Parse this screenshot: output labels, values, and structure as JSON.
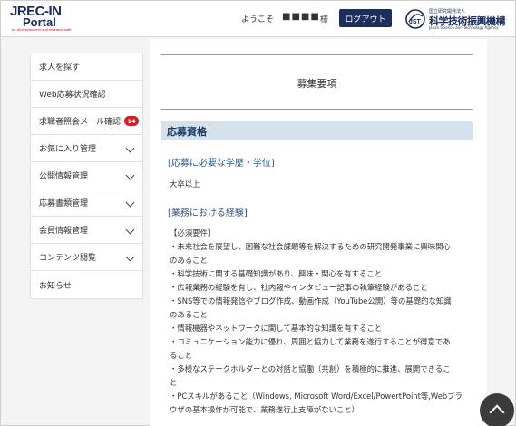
{
  "header": {
    "logo": {
      "line1": "JREC-IN",
      "line2": "Portal",
      "tagline": "for all researchers and research staff"
    },
    "welcome": "ようこそ",
    "username": "■■■■",
    "honorific": "様",
    "logout_label": "ログアウト",
    "jst": {
      "small_label": "国立研究開発法人",
      "name": "科学技術振興機構",
      "english": "Japan Science and Technology Agency",
      "icon_text": "JST"
    }
  },
  "sidebar": {
    "items": [
      {
        "label": "求人を探す",
        "chevron": false
      },
      {
        "label": "Web応募状況確認",
        "chevron": false
      },
      {
        "label": "求職者照会メール確認",
        "badge": "14",
        "chevron": false
      },
      {
        "label": "お気に入り管理",
        "chevron": true
      },
      {
        "label": "公開情報管理",
        "chevron": true
      },
      {
        "label": "応募書類管理",
        "chevron": true
      },
      {
        "label": "会員情報管理",
        "chevron": true
      },
      {
        "label": "コンテンツ閲覧",
        "chevron": true
      },
      {
        "label": "お知らせ",
        "chevron": false
      }
    ]
  },
  "main": {
    "page_title": "募集要項",
    "section_title": "応募資格",
    "subsections": [
      {
        "title": "[応募に必要な学歴・学位]",
        "lines": [
          "大卒以上"
        ]
      },
      {
        "title": "[業務における経験]",
        "lines": [
          "【必須要件】",
          "・未来社会を展望し、困難な社会課題等を解決するための研究開発事業に興味関心",
          "のあること",
          "・科学技術に関する基礎知識があり、興味・関心を有すること",
          "・広報業務の経験を有し、社内報やインタビュー記事の執筆経験があること",
          "・SNS等での情報発信やブログ作成、動画作成（YouTube公開）等の基礎的な知識",
          "のあること",
          "・情報機器やネットワークに関して基本的な知識を有すること",
          "・コミュニケーション能力に優れ、周囲と協力して業務を遂行することが得意であ",
          "ること",
          "・多様なステークホルダーとの対話と協働（共創）を積極的に推進、展開できるこ",
          "と",
          "・PCスキルがあること（Windows, Microsoft Word/Excel/PowertPoint等,Webブラ",
          "ウザの基本操作が可能で、業務遂行上支障がないこと）"
        ]
      }
    ]
  },
  "colors": {
    "header_navy": "#1c2f5c",
    "logo_red": "#c9102a",
    "section_bar_bg": "#d6e1ec",
    "section_text": "#1c3a66",
    "subsection_text": "#2f5a8a",
    "badge_red": "#cc1f2a"
  },
  "icons": {
    "scroll_top": "chevron-up-icon",
    "menu_chevron": "chevron-down-icon"
  }
}
